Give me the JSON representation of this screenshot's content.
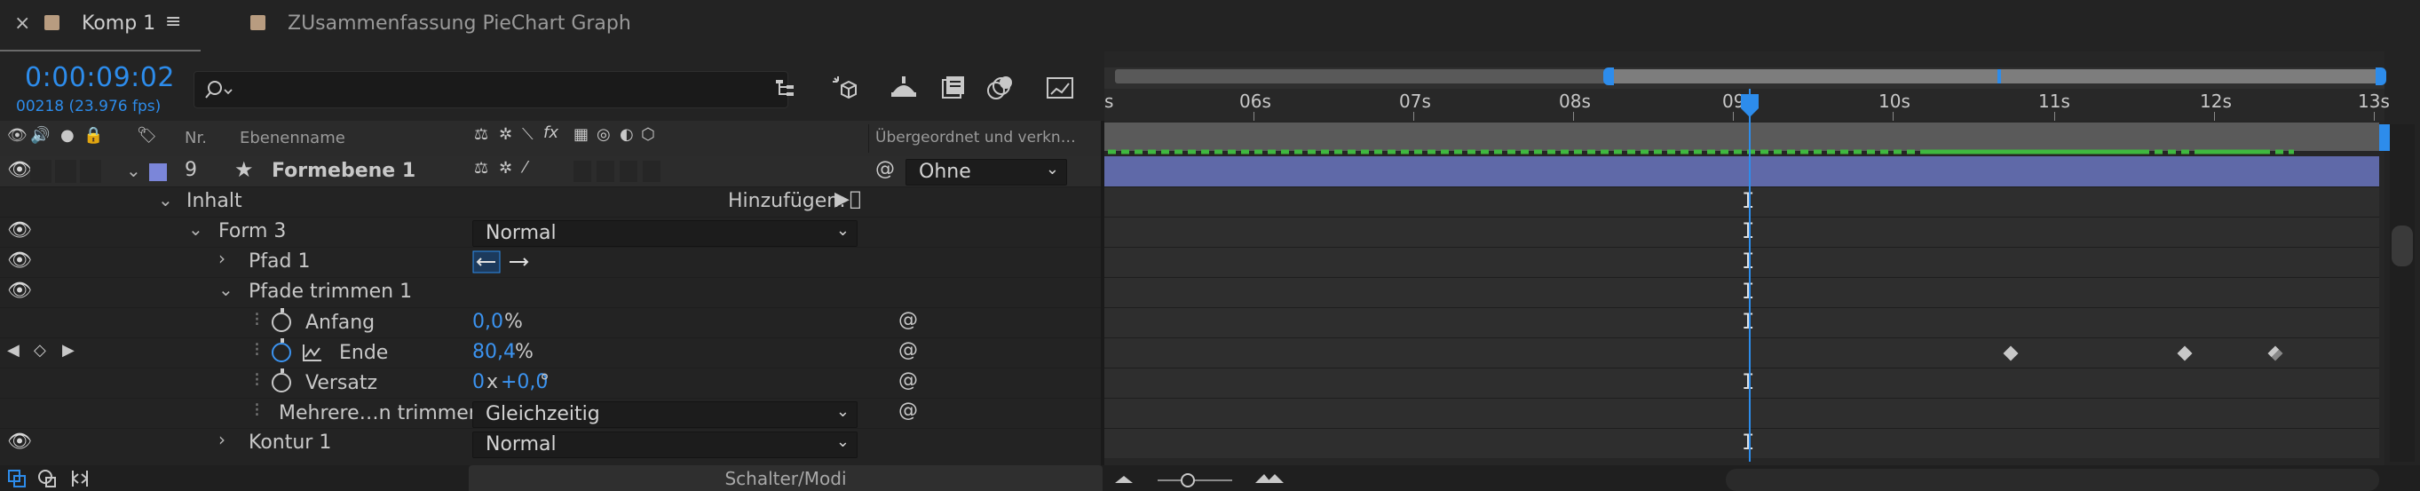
{
  "tabs": [
    {
      "close": "×",
      "label": "Komp 1",
      "menu": "≡"
    },
    {
      "label": "ZUsammenfassung PieChart Graph"
    }
  ],
  "timecode": "0:00:09:02",
  "frames": "00218 (23.976 fps)",
  "search": {
    "icon": "search-icon",
    "value": ""
  },
  "column_headers": {
    "nr": "Nr.",
    "layer_name": "Ebenenname",
    "parent": "Übergeordnet und verkn…"
  },
  "layer": {
    "number": "9",
    "name": "Formebene 1",
    "parent_value": "Ohne"
  },
  "rows": {
    "inhalt": "Inhalt",
    "hinzufuegen": "Hinzufügen:",
    "form3": "Form 3",
    "form3_mode": "Normal",
    "pfad1": "Pfad 1",
    "pfade_trimmen": "Pfade trimmen 1",
    "anfang_label": "Anfang",
    "anfang_value": "0,0",
    "anfang_unit": "%",
    "ende_label": "Ende",
    "ende_value": "80,4",
    "ende_unit": "%",
    "versatz_label": "Versatz",
    "versatz_rev": "0",
    "versatz_x": "x",
    "versatz_deg": "+0,0",
    "versatz_unit": "°",
    "mehrere_label": "Mehrere…n trimmen",
    "mehrere_value": "Gleichzeitig",
    "kontur_label": "Kontur 1",
    "kontur_mode": "Normal"
  },
  "ruler": {
    "labels": [
      "s",
      "06s",
      "07s",
      "08s",
      "09",
      "10s",
      "11s",
      "12s",
      "13s"
    ]
  },
  "footer": {
    "schalter_modi": "Schalter/Modi"
  },
  "colors": {
    "accent": "#2d8ceb",
    "layer_label": "#7b86d9",
    "layer_bar": "#5f69a8",
    "workarea_dots": "#3fb83f"
  }
}
